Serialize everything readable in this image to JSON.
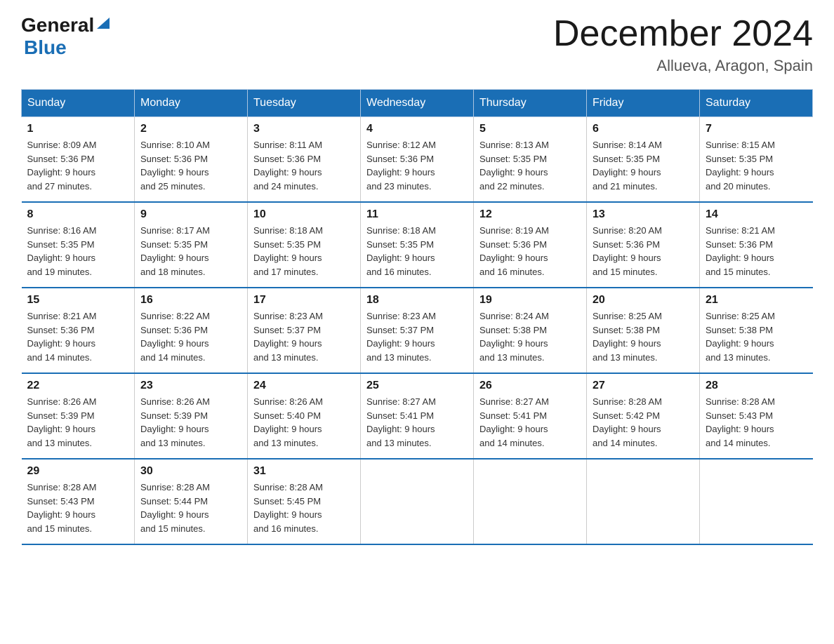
{
  "header": {
    "logo_line1": "General",
    "logo_line2": "Blue",
    "month_title": "December 2024",
    "location": "Allueva, Aragon, Spain"
  },
  "weekdays": [
    "Sunday",
    "Monday",
    "Tuesday",
    "Wednesday",
    "Thursday",
    "Friday",
    "Saturday"
  ],
  "weeks": [
    [
      {
        "day": "1",
        "sunrise": "8:09 AM",
        "sunset": "5:36 PM",
        "daylight": "9 hours and 27 minutes."
      },
      {
        "day": "2",
        "sunrise": "8:10 AM",
        "sunset": "5:36 PM",
        "daylight": "9 hours and 25 minutes."
      },
      {
        "day": "3",
        "sunrise": "8:11 AM",
        "sunset": "5:36 PM",
        "daylight": "9 hours and 24 minutes."
      },
      {
        "day": "4",
        "sunrise": "8:12 AM",
        "sunset": "5:36 PM",
        "daylight": "9 hours and 23 minutes."
      },
      {
        "day": "5",
        "sunrise": "8:13 AM",
        "sunset": "5:35 PM",
        "daylight": "9 hours and 22 minutes."
      },
      {
        "day": "6",
        "sunrise": "8:14 AM",
        "sunset": "5:35 PM",
        "daylight": "9 hours and 21 minutes."
      },
      {
        "day": "7",
        "sunrise": "8:15 AM",
        "sunset": "5:35 PM",
        "daylight": "9 hours and 20 minutes."
      }
    ],
    [
      {
        "day": "8",
        "sunrise": "8:16 AM",
        "sunset": "5:35 PM",
        "daylight": "9 hours and 19 minutes."
      },
      {
        "day": "9",
        "sunrise": "8:17 AM",
        "sunset": "5:35 PM",
        "daylight": "9 hours and 18 minutes."
      },
      {
        "day": "10",
        "sunrise": "8:18 AM",
        "sunset": "5:35 PM",
        "daylight": "9 hours and 17 minutes."
      },
      {
        "day": "11",
        "sunrise": "8:18 AM",
        "sunset": "5:35 PM",
        "daylight": "9 hours and 16 minutes."
      },
      {
        "day": "12",
        "sunrise": "8:19 AM",
        "sunset": "5:36 PM",
        "daylight": "9 hours and 16 minutes."
      },
      {
        "day": "13",
        "sunrise": "8:20 AM",
        "sunset": "5:36 PM",
        "daylight": "9 hours and 15 minutes."
      },
      {
        "day": "14",
        "sunrise": "8:21 AM",
        "sunset": "5:36 PM",
        "daylight": "9 hours and 15 minutes."
      }
    ],
    [
      {
        "day": "15",
        "sunrise": "8:21 AM",
        "sunset": "5:36 PM",
        "daylight": "9 hours and 14 minutes."
      },
      {
        "day": "16",
        "sunrise": "8:22 AM",
        "sunset": "5:36 PM",
        "daylight": "9 hours and 14 minutes."
      },
      {
        "day": "17",
        "sunrise": "8:23 AM",
        "sunset": "5:37 PM",
        "daylight": "9 hours and 13 minutes."
      },
      {
        "day": "18",
        "sunrise": "8:23 AM",
        "sunset": "5:37 PM",
        "daylight": "9 hours and 13 minutes."
      },
      {
        "day": "19",
        "sunrise": "8:24 AM",
        "sunset": "5:38 PM",
        "daylight": "9 hours and 13 minutes."
      },
      {
        "day": "20",
        "sunrise": "8:25 AM",
        "sunset": "5:38 PM",
        "daylight": "9 hours and 13 minutes."
      },
      {
        "day": "21",
        "sunrise": "8:25 AM",
        "sunset": "5:38 PM",
        "daylight": "9 hours and 13 minutes."
      }
    ],
    [
      {
        "day": "22",
        "sunrise": "8:26 AM",
        "sunset": "5:39 PM",
        "daylight": "9 hours and 13 minutes."
      },
      {
        "day": "23",
        "sunrise": "8:26 AM",
        "sunset": "5:39 PM",
        "daylight": "9 hours and 13 minutes."
      },
      {
        "day": "24",
        "sunrise": "8:26 AM",
        "sunset": "5:40 PM",
        "daylight": "9 hours and 13 minutes."
      },
      {
        "day": "25",
        "sunrise": "8:27 AM",
        "sunset": "5:41 PM",
        "daylight": "9 hours and 13 minutes."
      },
      {
        "day": "26",
        "sunrise": "8:27 AM",
        "sunset": "5:41 PM",
        "daylight": "9 hours and 14 minutes."
      },
      {
        "day": "27",
        "sunrise": "8:28 AM",
        "sunset": "5:42 PM",
        "daylight": "9 hours and 14 minutes."
      },
      {
        "day": "28",
        "sunrise": "8:28 AM",
        "sunset": "5:43 PM",
        "daylight": "9 hours and 14 minutes."
      }
    ],
    [
      {
        "day": "29",
        "sunrise": "8:28 AM",
        "sunset": "5:43 PM",
        "daylight": "9 hours and 15 minutes."
      },
      {
        "day": "30",
        "sunrise": "8:28 AM",
        "sunset": "5:44 PM",
        "daylight": "9 hours and 15 minutes."
      },
      {
        "day": "31",
        "sunrise": "8:28 AM",
        "sunset": "5:45 PM",
        "daylight": "9 hours and 16 minutes."
      },
      null,
      null,
      null,
      null
    ]
  ],
  "labels": {
    "sunrise": "Sunrise:",
    "sunset": "Sunset:",
    "daylight": "Daylight:"
  }
}
